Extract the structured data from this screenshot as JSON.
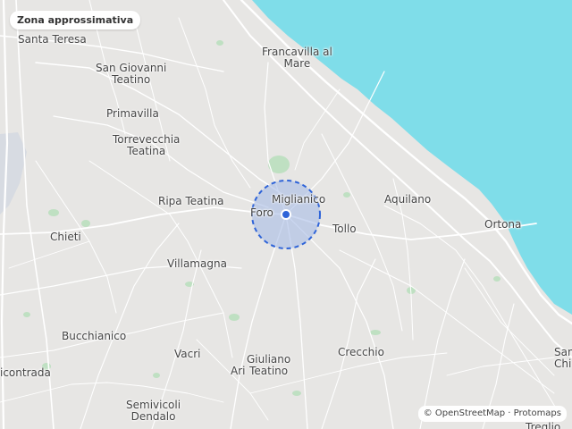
{
  "header": {
    "title": "Zona approssimativa"
  },
  "attribution": "© OpenStreetMap · Protomaps",
  "colors": {
    "land": "#e7e6e4",
    "sea": "#7fdde9",
    "roads": "#ffffff",
    "parks": "#bfe0c2",
    "area_fill": "#a9bde6",
    "area_stroke": "#2f64d8",
    "marker": "#2f64d8"
  },
  "places": [
    {
      "id": "santa-teresa",
      "name": "Santa Teresa"
    },
    {
      "id": "francavilla",
      "name": "Francavilla al\nMare"
    },
    {
      "id": "san-giovanni",
      "name": "San Giovanni\nTeatino"
    },
    {
      "id": "primavilla",
      "name": "Primavilla"
    },
    {
      "id": "torrevecchia",
      "name": "Torrevecchia\nTeatina"
    },
    {
      "id": "ripa-teatina",
      "name": "Ripa Teatina"
    },
    {
      "id": "miglianico",
      "name": "Miglianico"
    },
    {
      "id": "foro",
      "name": "Foro"
    },
    {
      "id": "aquilano",
      "name": "Aquilano"
    },
    {
      "id": "tollo",
      "name": "Tollo"
    },
    {
      "id": "ortona",
      "name": "Ortona"
    },
    {
      "id": "chieti",
      "name": "Chieti"
    },
    {
      "id": "villamagna",
      "name": "Villamagna"
    },
    {
      "id": "bucchianico",
      "name": "Bucchianico"
    },
    {
      "id": "vacri",
      "name": "Vacri"
    },
    {
      "id": "giuliano",
      "name": "Giuliano\nTeatino"
    },
    {
      "id": "ari",
      "name": "Ari"
    },
    {
      "id": "crecchio",
      "name": "Crecchio"
    },
    {
      "id": "contrada",
      "name": "icontrada"
    },
    {
      "id": "semivicoli",
      "name": "Semivicoli\nDendalo"
    },
    {
      "id": "san-edge",
      "name": "San\nChi"
    },
    {
      "id": "treglio",
      "name": "Treglio"
    }
  ]
}
